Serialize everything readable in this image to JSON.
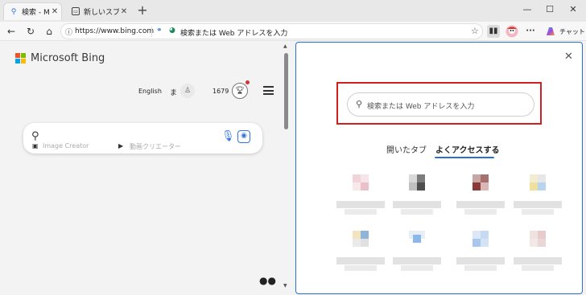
{
  "tabs": [
    {
      "label": "検索 - Microsoft Bing",
      "display": "検索 - Micro",
      "icon": "search-icon"
    },
    {
      "label": "新しいスプリット",
      "display": "新しいスプリ",
      "icon": "new-tab-page-icon"
    }
  ],
  "address_bar": {
    "url": "https://www.bing.com",
    "placeholder": "検索または Web アドレスを入力"
  },
  "toolbar": {
    "chat_label": "チャット"
  },
  "bing": {
    "brand": "Microsoft Bing",
    "language": "English",
    "user_initial": "ま",
    "points": "1679",
    "search_options": [
      "Image Creator",
      "動画クリエーター"
    ]
  },
  "new_tab_panel": {
    "search_placeholder": "検索または Web アドレスを入力",
    "tabs": [
      {
        "label": "開いたタブ",
        "selected": false
      },
      {
        "label": "よくアクセスする",
        "selected": true
      }
    ],
    "tile_count": 8
  },
  "colors": {
    "accent": "#2b6fd6",
    "highlight": "#d21f1f",
    "ms_red": "#f25022",
    "ms_green": "#7fba00",
    "ms_blue": "#00a4ef",
    "ms_yellow": "#ffb900"
  }
}
